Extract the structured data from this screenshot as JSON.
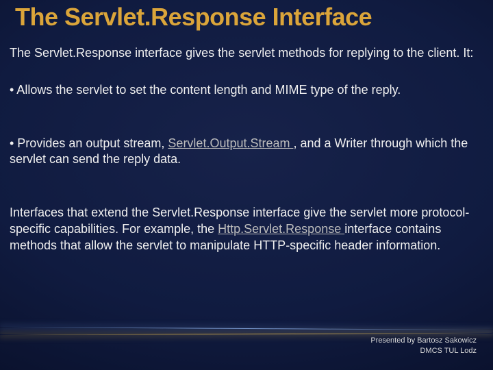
{
  "title": "The Servlet.Response Interface",
  "intro": {
    "pre": "The ",
    "code": "Servlet.Response",
    "post": " interface gives the servlet methods for replying to the client. It:"
  },
  "bullet1": "• Allows the servlet to set the content length and MIME type of the reply.",
  "bullet2": {
    "pre": "• Provides an output stream, ",
    "link": "Servlet.Output.Stream ",
    "mid1": ", and a ",
    "writer": "Writer",
    "post1": " through which the servlet can send the reply data."
  },
  "para": {
    "pre": "Interfaces that extend the ",
    "code": "Servlet.Response",
    "mid": " interface give the servlet more protocol-specific capabilities. For example, the ",
    "link": "Http.Servlet.Response ",
    "post": "interface contains methods that allow the servlet to manipulate HTTP-specific header information."
  },
  "footer": {
    "line1": "Presented by Bartosz  Sakowicz",
    "line2": "DMCS TUL Lodz"
  }
}
